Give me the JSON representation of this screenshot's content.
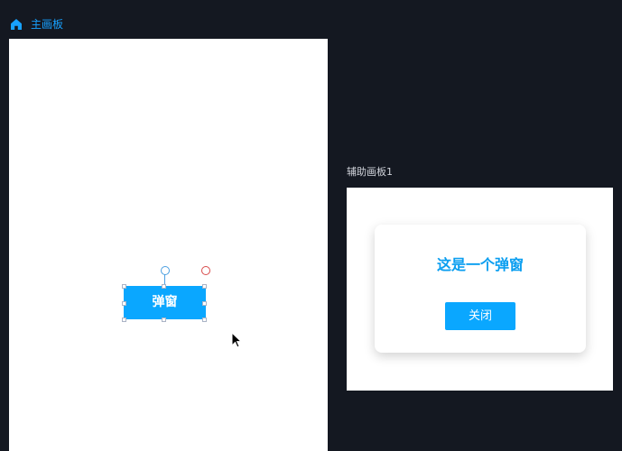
{
  "top_bar": {
    "home_icon": "home-icon",
    "title": "主画板"
  },
  "canvas": {
    "main_board": {
      "selected_button_label": "弹窗"
    },
    "aux_board": {
      "label": "辅助画板1",
      "dialog": {
        "title": "这是一个弹窗",
        "close_label": "关闭"
      }
    }
  },
  "colors": {
    "background": "#141821",
    "accent": "#0aa7ff",
    "text_accent": "#17a1ff",
    "danger": "#d84a4a"
  }
}
